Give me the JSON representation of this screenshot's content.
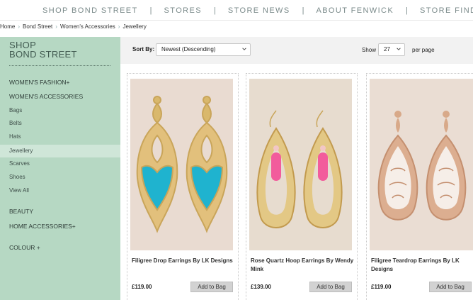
{
  "topnav": {
    "items": [
      "SHOP BOND STREET",
      "STORES",
      "STORE NEWS",
      "ABOUT FENWICK",
      "STORE FINDER"
    ],
    "separator": "|"
  },
  "breadcrumb": {
    "items": [
      "Home",
      "Bond Street",
      "Women's Accessories",
      "Jewellery"
    ]
  },
  "sidebar": {
    "title_line1": "SHOP",
    "title_line2": "BOND STREET",
    "items": [
      {
        "label": "WOMEN'S FASHION+"
      },
      {
        "label": "WOMEN'S ACCESSORIES"
      },
      {
        "label": "Bags"
      },
      {
        "label": "Belts"
      },
      {
        "label": "Hats"
      },
      {
        "label": "Jewellery"
      },
      {
        "label": "Scarves"
      },
      {
        "label": "Shoes"
      },
      {
        "label": "View All"
      },
      {
        "label": "BEAUTY"
      },
      {
        "label": "HOME ACCESSORIES+"
      },
      {
        "label": "COLOUR +"
      }
    ],
    "selected": "Jewellery"
  },
  "sortbar": {
    "sort_label": "Sort By:",
    "sort_value": "Newest (Descending)",
    "show_label": "Show",
    "show_value": "27",
    "per_page_label": "per page"
  },
  "products": [
    {
      "name": "Filigree Drop Earrings By LK Designs",
      "price": "£119.00",
      "button": "Add to Bag",
      "image": "turquoise-gold-filigree-earrings"
    },
    {
      "name": "Rose Quartz Hoop Earrings By Wendy Mink",
      "price": "£139.00",
      "button": "Add to Bag",
      "image": "gold-hoop-pink-drop-earrings"
    },
    {
      "name": "Filigree Teardrop Earrings By LK Designs",
      "price": "£119.00",
      "button": "Add to Bag",
      "image": "rose-gold-teardrop-earrings"
    }
  ],
  "colors": {
    "sidebar_bg": "#b6d8c3",
    "sidebar_active": "#cfe6d8",
    "nav_text": "#7a8a8a",
    "button_bg": "#d2d2d2"
  }
}
